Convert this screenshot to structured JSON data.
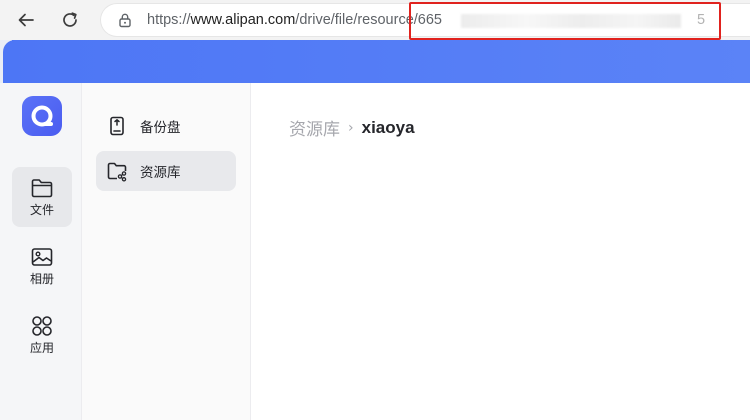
{
  "browser": {
    "url_prefix": "https://",
    "url_host": "www.alipan.com",
    "url_path": "/drive/file/resource/665",
    "url_tail": "5",
    "back_icon": "arrow-left-icon",
    "reload_icon": "reload-icon",
    "lock_icon": "lock-icon",
    "highlight_color": "#e0221e"
  },
  "banner": {
    "color": "#5079f5"
  },
  "rail": {
    "logo_icon": "alipan-logo-icon",
    "items": [
      {
        "label": "文件",
        "icon": "folder-icon",
        "active": true
      },
      {
        "label": "相册",
        "icon": "photo-icon",
        "active": false
      },
      {
        "label": "应用",
        "icon": "apps-grid-icon",
        "active": false
      }
    ]
  },
  "subnav": {
    "items": [
      {
        "label": "备份盘",
        "icon": "backup-drive-icon",
        "active": false
      },
      {
        "label": "资源库",
        "icon": "shared-folder-icon",
        "active": true
      }
    ]
  },
  "main": {
    "breadcrumb": {
      "parent": "资源库",
      "separator": "›",
      "current": "xiaoya"
    }
  }
}
